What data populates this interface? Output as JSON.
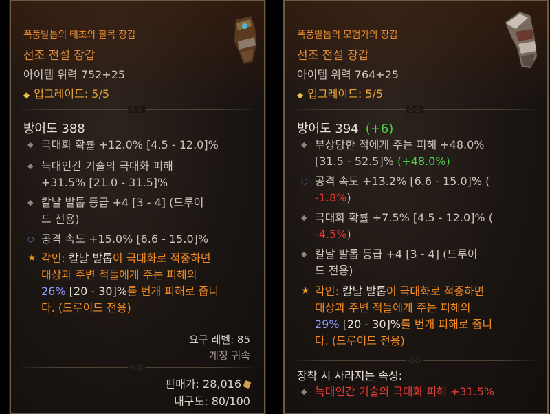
{
  "left": {
    "name": "폭풍발톱의 태초의 팔목 장갑",
    "rarity": "선조 전설 장갑",
    "power": "아이템 위력 752+25",
    "upgrade": "업그레이드: 5/5",
    "armor": "방어도 388",
    "affixes": [
      {
        "line1": "극대화 확률 +12.0% [4.5 - 12.0]%"
      },
      {
        "line1": "늑대인간 기술의 극대화 피해",
        "line2": "+31.5% [21.0 - 31.5]%"
      },
      {
        "line1": "칼날 발톱 등급 +4 [3 - 4] (드루이",
        "line2": "드 전용)"
      },
      {
        "line1": "공격 속도 +15.0% [6.6 - 15.0]%"
      }
    ],
    "aspect": {
      "label": "각인:",
      "skill": "칼날 발톱",
      "l1_rest": "이 극대화로 적중하면",
      "line2": "대상과 주변 적들에게 주는 피해의",
      "value": "26%",
      "range": "[20 - 30]%",
      "l3_rest": "를 번개 피해로 줍니",
      "line4": "다. (드루이드 전용)"
    },
    "required_level": "요구 레벨: 85",
    "account_bound": "계정 귀속",
    "sell_value": "판매가: 28,016",
    "durability": "내구도: 80/100"
  },
  "right": {
    "name": "폭풍발톱의 모험가의 장갑",
    "rarity": "선조 전설 장갑",
    "power": "아이템 위력 764+25",
    "upgrade": "업그레이드: 5/5",
    "armor": "방어도 394",
    "armor_bonus": "(+6)",
    "affixes": [
      {
        "line1": "부상당한 적에게 주는 피해 +48.0%",
        "line2": "[31.5 - 52.5]%",
        "bonus": "(+48.0%)"
      },
      {
        "line1": "공격 속도 +13.2% [6.6 - 15.0]% (",
        "line2": "-1.8%",
        "close": ")"
      },
      {
        "line1": "극대화 확률 +7.5% [4.5 - 12.0]% (",
        "line2": "-4.5%",
        "close": ")"
      },
      {
        "line1": "칼날 발톱 등급 +4 [3 - 4] (드루이",
        "line2": "드 전용)"
      }
    ],
    "aspect": {
      "label": "각인:",
      "skill": "칼날 발톱",
      "l1_rest": "이 극대화로 적중하면",
      "line2": "대상과 주변 적들에게 주는 피해의",
      "value": "29%",
      "range": "[20 - 30]%",
      "l3_rest": "를 번개 피해로 줍니",
      "line4": "다. (드루이드 전용)"
    },
    "lost_title": "장착 시 사라지는 속성:",
    "lost_affix": "늑대인간 기술의 극대화 피해 +31.5%"
  },
  "icons": [
    "upgrade-diamond-icon",
    "affix-bullet-icon",
    "attack-speed-bullet-icon",
    "aspect-star-icon",
    "gold-coin-icon",
    "glove-item-icon"
  ],
  "colors": {
    "legendary": "#e28a37",
    "bonus_green": "#4bd24b",
    "penalty_red": "#e23a34",
    "aspect_orange": "#f08a24",
    "aspect_value": "#8e9aff"
  }
}
